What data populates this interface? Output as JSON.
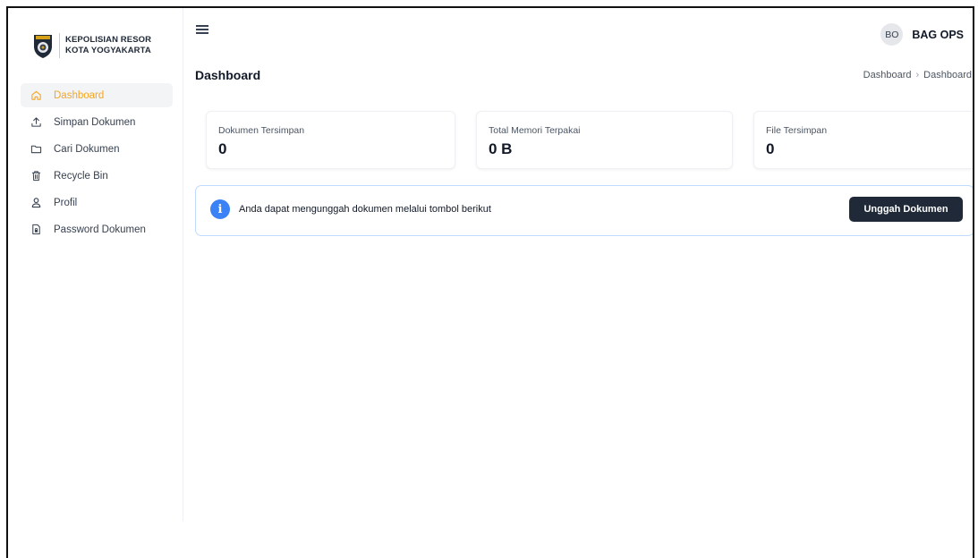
{
  "brand": {
    "line1": "KEPOLISIAN RESOR",
    "line2": "KOTA YOGYAKARTA"
  },
  "colors": {
    "accent": "#f5a623",
    "info": "#3b82f6",
    "button": "#1f2937"
  },
  "sidebar": {
    "items": [
      {
        "label": "Dashboard",
        "icon": "home-icon",
        "active": true
      },
      {
        "label": "Simpan Dokumen",
        "icon": "upload-icon"
      },
      {
        "label": "Cari Dokumen",
        "icon": "folder-icon"
      },
      {
        "label": "Recycle Bin",
        "icon": "trash-icon"
      },
      {
        "label": "Profil",
        "icon": "user-icon"
      },
      {
        "label": "Password Dokumen",
        "icon": "file-lock-icon"
      }
    ]
  },
  "header": {
    "avatar_initials": "BO",
    "user_name": "BAG OPS"
  },
  "page": {
    "title": "Dashboard",
    "breadcrumb": [
      "Dashboard",
      "Dashboard"
    ]
  },
  "stats": [
    {
      "label": "Dokumen Tersimpan",
      "value": "0"
    },
    {
      "label": "Total Memori Terpakai",
      "value": "0 B"
    },
    {
      "label": "File Tersimpan",
      "value": "0"
    }
  ],
  "info": {
    "message": "Anda dapat mengunggah dokumen melalui tombol berikut",
    "button_label": "Unggah Dokumen"
  }
}
